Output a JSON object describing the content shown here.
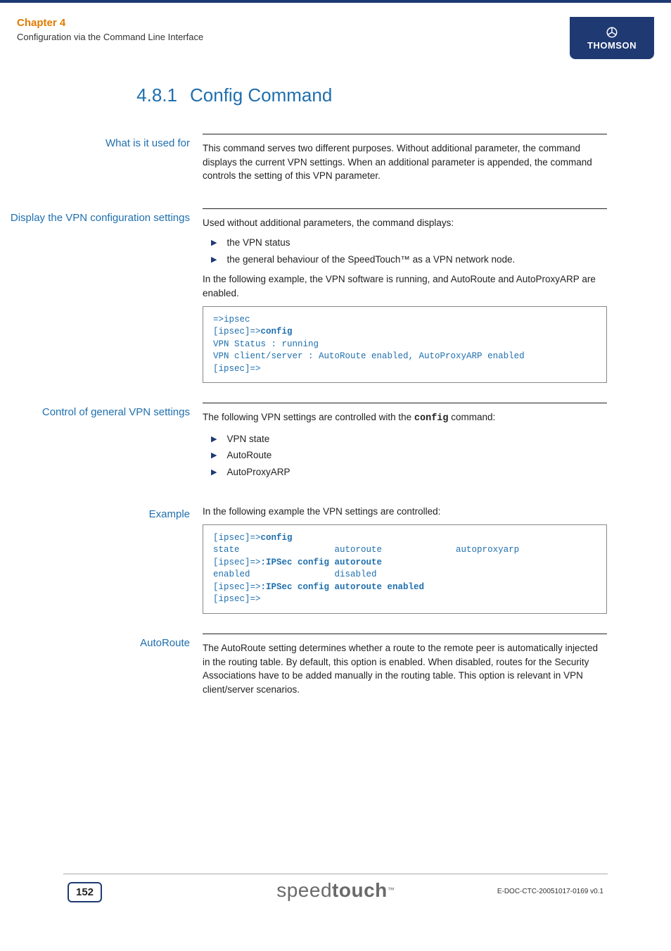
{
  "header": {
    "chapter": "Chapter 4",
    "subtitle": "Configuration via the Command Line Interface",
    "brand_badge": "THOMSON"
  },
  "title": {
    "number": "4.8.1",
    "text": "Config Command"
  },
  "sections": {
    "s1": {
      "label": "What is it used for",
      "para1": "This command serves two different purposes. Without additional parameter, the command displays the current VPN settings. When an additional parameter is appended, the command controls the setting of this VPN parameter."
    },
    "s2": {
      "label": "Display the VPN configuration settings",
      "para1": "Used without additional parameters, the command displays:",
      "bul1": "the VPN status",
      "bul2": "the general behaviour of the SpeedTouch™ as a VPN network node.",
      "para2": "In the following example, the VPN software is running, and AutoRoute and AutoProxyARP are enabled."
    },
    "s3": {
      "label": "Control of general VPN settings",
      "para1a": "The following VPN settings are controlled with the ",
      "para1b": "config",
      "para1c": " command:",
      "bul1": "VPN state",
      "bul2": "AutoRoute",
      "bul3": "AutoProxyARP"
    },
    "s4": {
      "label": "Example",
      "para1": "In the following example the VPN settings are controlled:"
    },
    "s5": {
      "label": "AutoRoute",
      "para1": "The AutoRoute setting determines whether a route to the remote peer is automatically injected in the routing table. By default, this option is enabled. When disabled, routes for the Security Associations have to be added manually in the routing table. This option is relevant in VPN client/server scenarios."
    }
  },
  "code": {
    "c1_l1": "=>ipsec",
    "c1_l2a": "[ipsec]=>",
    "c1_l2b": "config",
    "c1_l3": "VPN Status : running",
    "c1_l4": "VPN client/server : AutoRoute enabled, AutoProxyARP enabled",
    "c1_l5": "[ipsec]=>",
    "c2_l1a": "[ipsec]=>",
    "c2_l1b": "config",
    "c2_l2": "state                  autoroute              autoproxyarp",
    "c2_l3a": "[ipsec]=>",
    "c2_l3b": ":IPSec config autoroute",
    "c2_l4": "enabled                disabled",
    "c2_l5a": "[ipsec]=>",
    "c2_l5b": ":IPSec config autoroute enabled",
    "c2_l6": "[ipsec]=>"
  },
  "footer": {
    "page_num": "152",
    "brand_light": "speed",
    "brand_bold": "touch",
    "doc_id": "E-DOC-CTC-20051017-0169 v0.1"
  }
}
